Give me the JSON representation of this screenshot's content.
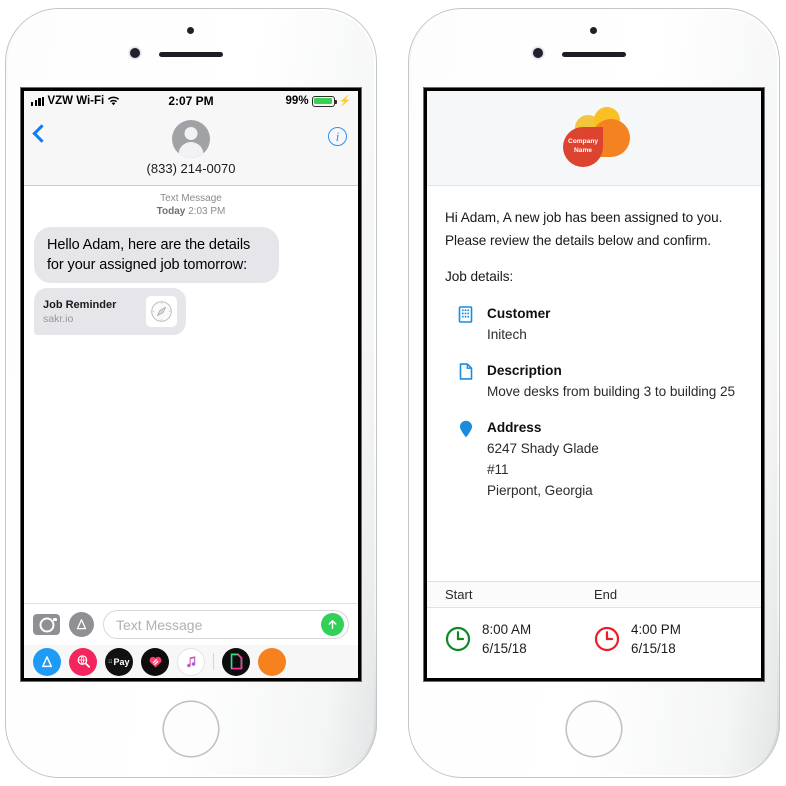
{
  "left_phone": {
    "status_bar": {
      "carrier": "VZW Wi-Fi",
      "time": "2:07 PM",
      "battery_percent": "99%",
      "signal_icon": "signal-bars-icon",
      "wifi_icon": "wifi-icon",
      "battery_icon": "battery-icon",
      "charging_icon": "lightning-bolt-icon"
    },
    "nav": {
      "back_icon": "back-chevron-icon",
      "info_icon": "info-icon",
      "info_label": "i",
      "avatar_icon": "contact-avatar-icon",
      "contact": "(833) 214-0070"
    },
    "thread": {
      "service_label": "Text Message",
      "timestamp_day": "Today",
      "timestamp_time": "2:03 PM",
      "message": "Hello Adam, here are the details for your assigned job tomorrow:",
      "link_preview": {
        "title": "Job Reminder",
        "host": "sakr.io",
        "icon": "safari-compass-icon"
      }
    },
    "composer": {
      "camera_icon": "camera-icon",
      "appstore_icon": "app-store-icon",
      "placeholder": "Text Message",
      "send_icon": "send-arrow-up-icon"
    },
    "app_drawer": [
      {
        "name": "app-store",
        "label": "A",
        "color": "#1d9bf6"
      },
      {
        "name": "image-search",
        "label": "",
        "color": "#f4245e"
      },
      {
        "name": "apple-pay",
        "label": "Pay",
        "color": "#111111"
      },
      {
        "name": "digital-touch",
        "label": "",
        "color": "#0d0d0d"
      },
      {
        "name": "apple-music",
        "label": "",
        "color": "#ffffff"
      },
      {
        "name": "files",
        "label": "",
        "color": "#0d0d0d"
      },
      {
        "name": "more-apps",
        "label": "",
        "color": "#f5821f"
      }
    ]
  },
  "right_phone": {
    "logo": {
      "company_line1": "Company",
      "company_line2": "Name",
      "colors": [
        "#f3c53c",
        "#f9bf23",
        "#f58220",
        "#dd4430"
      ]
    },
    "intro": [
      "Hi Adam, A new job has been assigned to you. Please review the details below and confirm.",
      "Job details:"
    ],
    "details": [
      {
        "icon": "building-icon",
        "label": "Customer",
        "value": "Initech"
      },
      {
        "icon": "document-icon",
        "label": "Description",
        "value": "Move desks from building 3 to building 25"
      },
      {
        "icon": "map-pin-icon",
        "label": "Address",
        "value": "6247 Shady Glade\n#11\nPierpont, Georgia"
      }
    ],
    "schedule": {
      "start_header": "Start",
      "end_header": "End",
      "start": {
        "icon": "clock-icon-green",
        "color": "#0b8a26",
        "time": "8:00 AM",
        "date": "6/15/18"
      },
      "end": {
        "icon": "clock-icon-red",
        "color": "#ee1c25",
        "time": "4:00 PM",
        "date": "6/15/18"
      }
    }
  },
  "theme": {
    "accent_blue": "#0a7cff",
    "bubble_gray": "#e6e5ea",
    "send_green": "#31d158",
    "icon_blue": "#1a8cdd"
  }
}
